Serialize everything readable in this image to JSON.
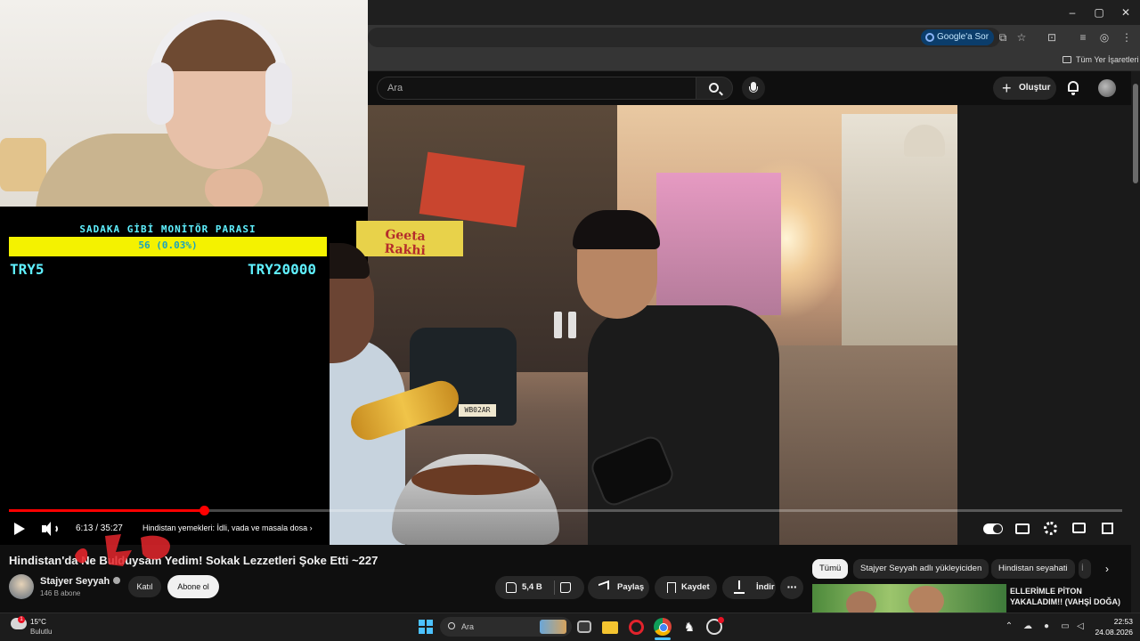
{
  "browser": {
    "window_controls": {
      "minimize": "–",
      "maximize": "▢",
      "close": "✕"
    },
    "google_ask": "Google'a Sor",
    "all_bookmarks": "Tüm Yer İşaretleri"
  },
  "youtube": {
    "search_placeholder": "Ara",
    "create_label": "Oluştur"
  },
  "overlay_goal": {
    "title": "SADAKA GİBİ MONİTÖR PARASI",
    "count_text": "56 (0.03%)",
    "min_label": "TRY5",
    "max_label": "TRY20000",
    "progress_fraction": 0.0003
  },
  "video_scene": {
    "shop_sign": "Geeta Rakhi",
    "plate_text": "WB02AR"
  },
  "player": {
    "time_current": "6:13",
    "time_total": "35:27",
    "time_display": "6:13 / 35:27",
    "chapter_text": "Hindistan yemekleri: İdli, vada ve masala dosa",
    "progress_fraction": 0.175
  },
  "video": {
    "title": "Hindistan'da Ne Bulduysam Yedim! Sokak Lezzetleri Şoke Etti ~227",
    "channel_name": "Stajyer Seyyah",
    "subscribers": "146 B abone",
    "join_label": "Katıl",
    "subscribe_label": "Abone ol",
    "likes": "5,4 B",
    "share_label": "Paylaş",
    "save_label": "Kaydet",
    "download_label": "İndir",
    "more_label": "···"
  },
  "sidebar": {
    "chips": [
      "Tümü",
      "Stajyer Seyyah adlı yükleyiciden",
      "Hindistan seyahati",
      "İ"
    ],
    "next_arrow": "›",
    "recommended_title": "ELLERİMLE PİTON YAKALADIM!! (VAHŞİ DOĞA)"
  },
  "taskbar": {
    "weather_temp": "15°C",
    "weather_desc": "Bulutlu",
    "weather_badge": "1",
    "search_placeholder": "Ara",
    "clock_time": "22:53",
    "clock_date": "24.08.2026"
  },
  "colors": {
    "accent_red": "#ff0000",
    "goal_fill": "#f4f200",
    "goal_text": "#5ff0ff",
    "taskbar_accent": "#4cc2ff"
  }
}
